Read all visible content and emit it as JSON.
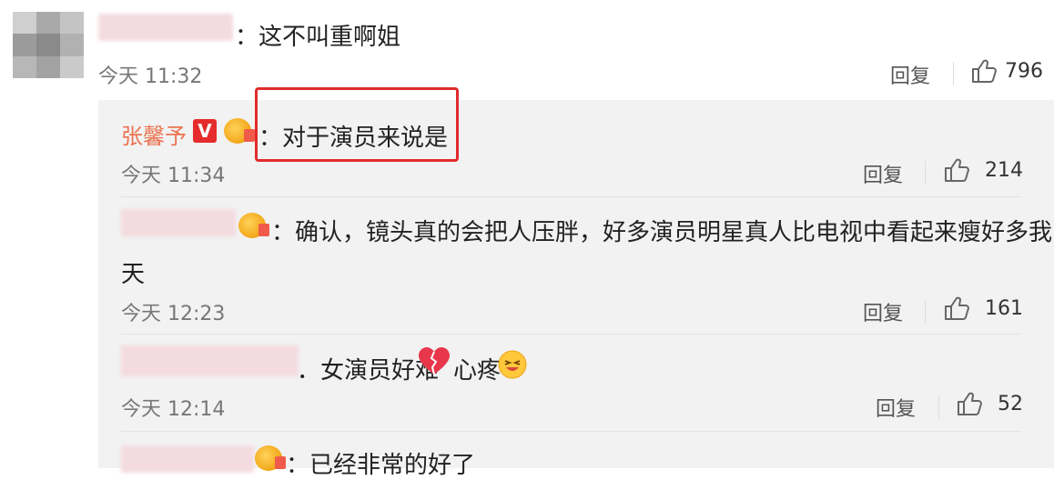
{
  "comment_top": {
    "text": "：这不叫重啊姐",
    "time": "今天 11:32",
    "reply_label": "回复",
    "likes": "796"
  },
  "replies": [
    {
      "author": "张馨予",
      "text": "：对于演员来说是",
      "time": "今天 11:34",
      "reply_label": "回复",
      "likes": "214"
    },
    {
      "text_line1": "：确认，镜头真的会把人压胖，好多演员明星真人比电视中看起来瘦好多我的",
      "text_line2": "天",
      "time": "今天 12:23",
      "reply_label": "回复",
      "likes": "161"
    },
    {
      "text_a": "．女演员好难",
      "text_b": "心疼",
      "time": "今天 12:14",
      "reply_label": "回复",
      "likes": "52"
    },
    {
      "text": "：已经非常的好了"
    }
  ],
  "badges": {
    "verified_letter": "V"
  },
  "colors": {
    "highlight": "#e02b2b",
    "author_name": "#eb7350",
    "reply_bg": "#f2f2f2"
  }
}
